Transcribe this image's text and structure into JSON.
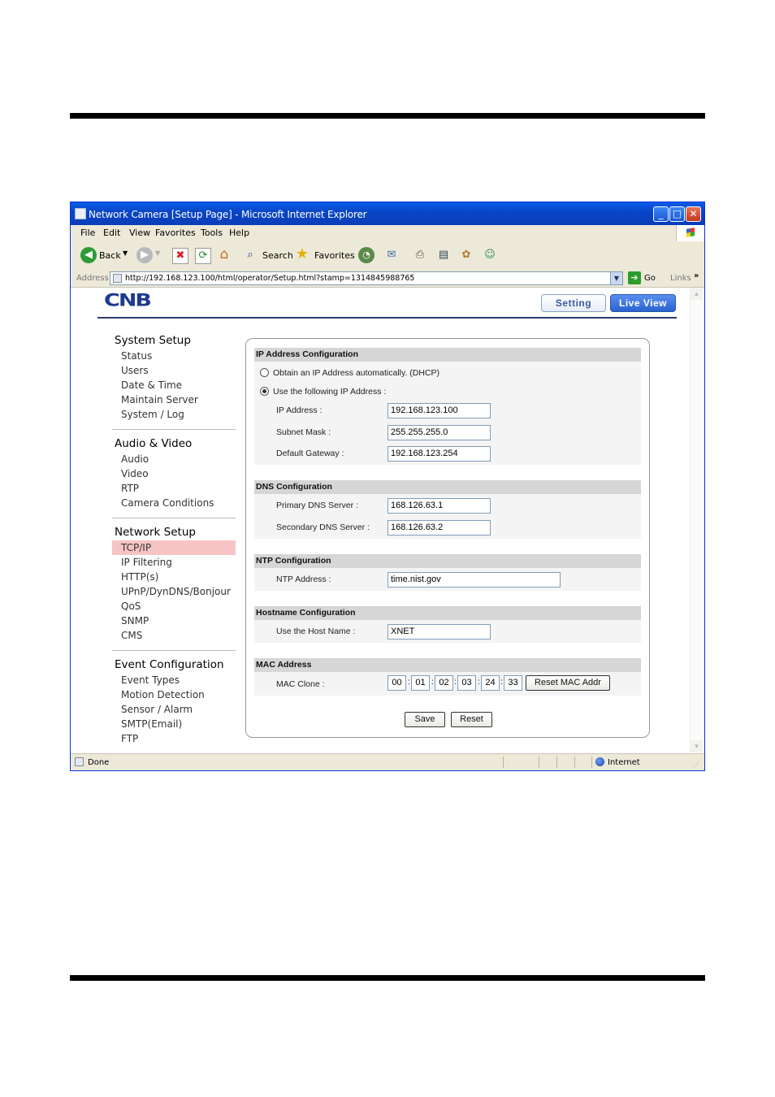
{
  "window": {
    "title": "Network Camera [Setup Page] - Microsoft Internet Explorer",
    "controls": {
      "minimize": "_",
      "maximize": "□",
      "close": "✕"
    }
  },
  "menu": [
    "File",
    "Edit",
    "View",
    "Favorites",
    "Tools",
    "Help"
  ],
  "toolbar": {
    "back": "Back",
    "search": "Search",
    "favorites": "Favorites"
  },
  "address": {
    "label": "Address",
    "url": "http://192.168.123.100/html/operator/Setup.html?stamp=1314845988765",
    "go": "Go",
    "links": "Links",
    "more": "»"
  },
  "header": {
    "logo": "CNB",
    "setting": "Setting",
    "live_view": "Live View"
  },
  "nav": {
    "system": {
      "title": "System Setup",
      "items": [
        "Status",
        "Users",
        "Date & Time",
        "Maintain Server",
        "System / Log"
      ]
    },
    "audio": {
      "title": "Audio & Video",
      "items": [
        "Audio",
        "Video",
        "RTP",
        "Camera Conditions"
      ]
    },
    "network": {
      "title": "Network Setup",
      "items": [
        "TCP/IP",
        "IP Filtering",
        "HTTP(s)",
        "UPnP/DynDNS/Bonjour",
        "QoS",
        "SNMP",
        "CMS"
      ]
    },
    "event": {
      "title": "Event Configuration",
      "items": [
        "Event Types",
        "Motion Detection",
        "Sensor / Alarm",
        "SMTP(Email)",
        "FTP"
      ]
    }
  },
  "ip": {
    "header": "IP Address Configuration",
    "dhcp_label": "Obtain an IP Address automatically. (DHCP)",
    "static_label": "Use the following IP Address :",
    "ip_label": "IP Address :",
    "ip_value": "192.168.123.100",
    "mask_label": "Subnet Mask :",
    "mask_value": "255.255.255.0",
    "gw_label": "Default Gateway :",
    "gw_value": "192.168.123.254"
  },
  "dns": {
    "header": "DNS Configuration",
    "primary_label": "Primary DNS Server :",
    "primary_value": "168.126.63.1",
    "secondary_label": "Secondary DNS Server :",
    "secondary_value": "168.126.63.2"
  },
  "ntp": {
    "header": "NTP Configuration",
    "label": "NTP Address :",
    "value": "time.nist.gov"
  },
  "hostname": {
    "header": "Hostname Configuration",
    "label": "Use the Host Name :",
    "value": "XNET"
  },
  "mac": {
    "header": "MAC Address",
    "label": "MAC Clone :",
    "octets": [
      "00",
      "01",
      "02",
      "03",
      "24",
      "33"
    ],
    "sep": ":",
    "reset_label": "Reset MAC Addr"
  },
  "buttons": {
    "save": "Save",
    "reset": "Reset"
  },
  "status": {
    "left": "Done",
    "zone": "Internet"
  }
}
